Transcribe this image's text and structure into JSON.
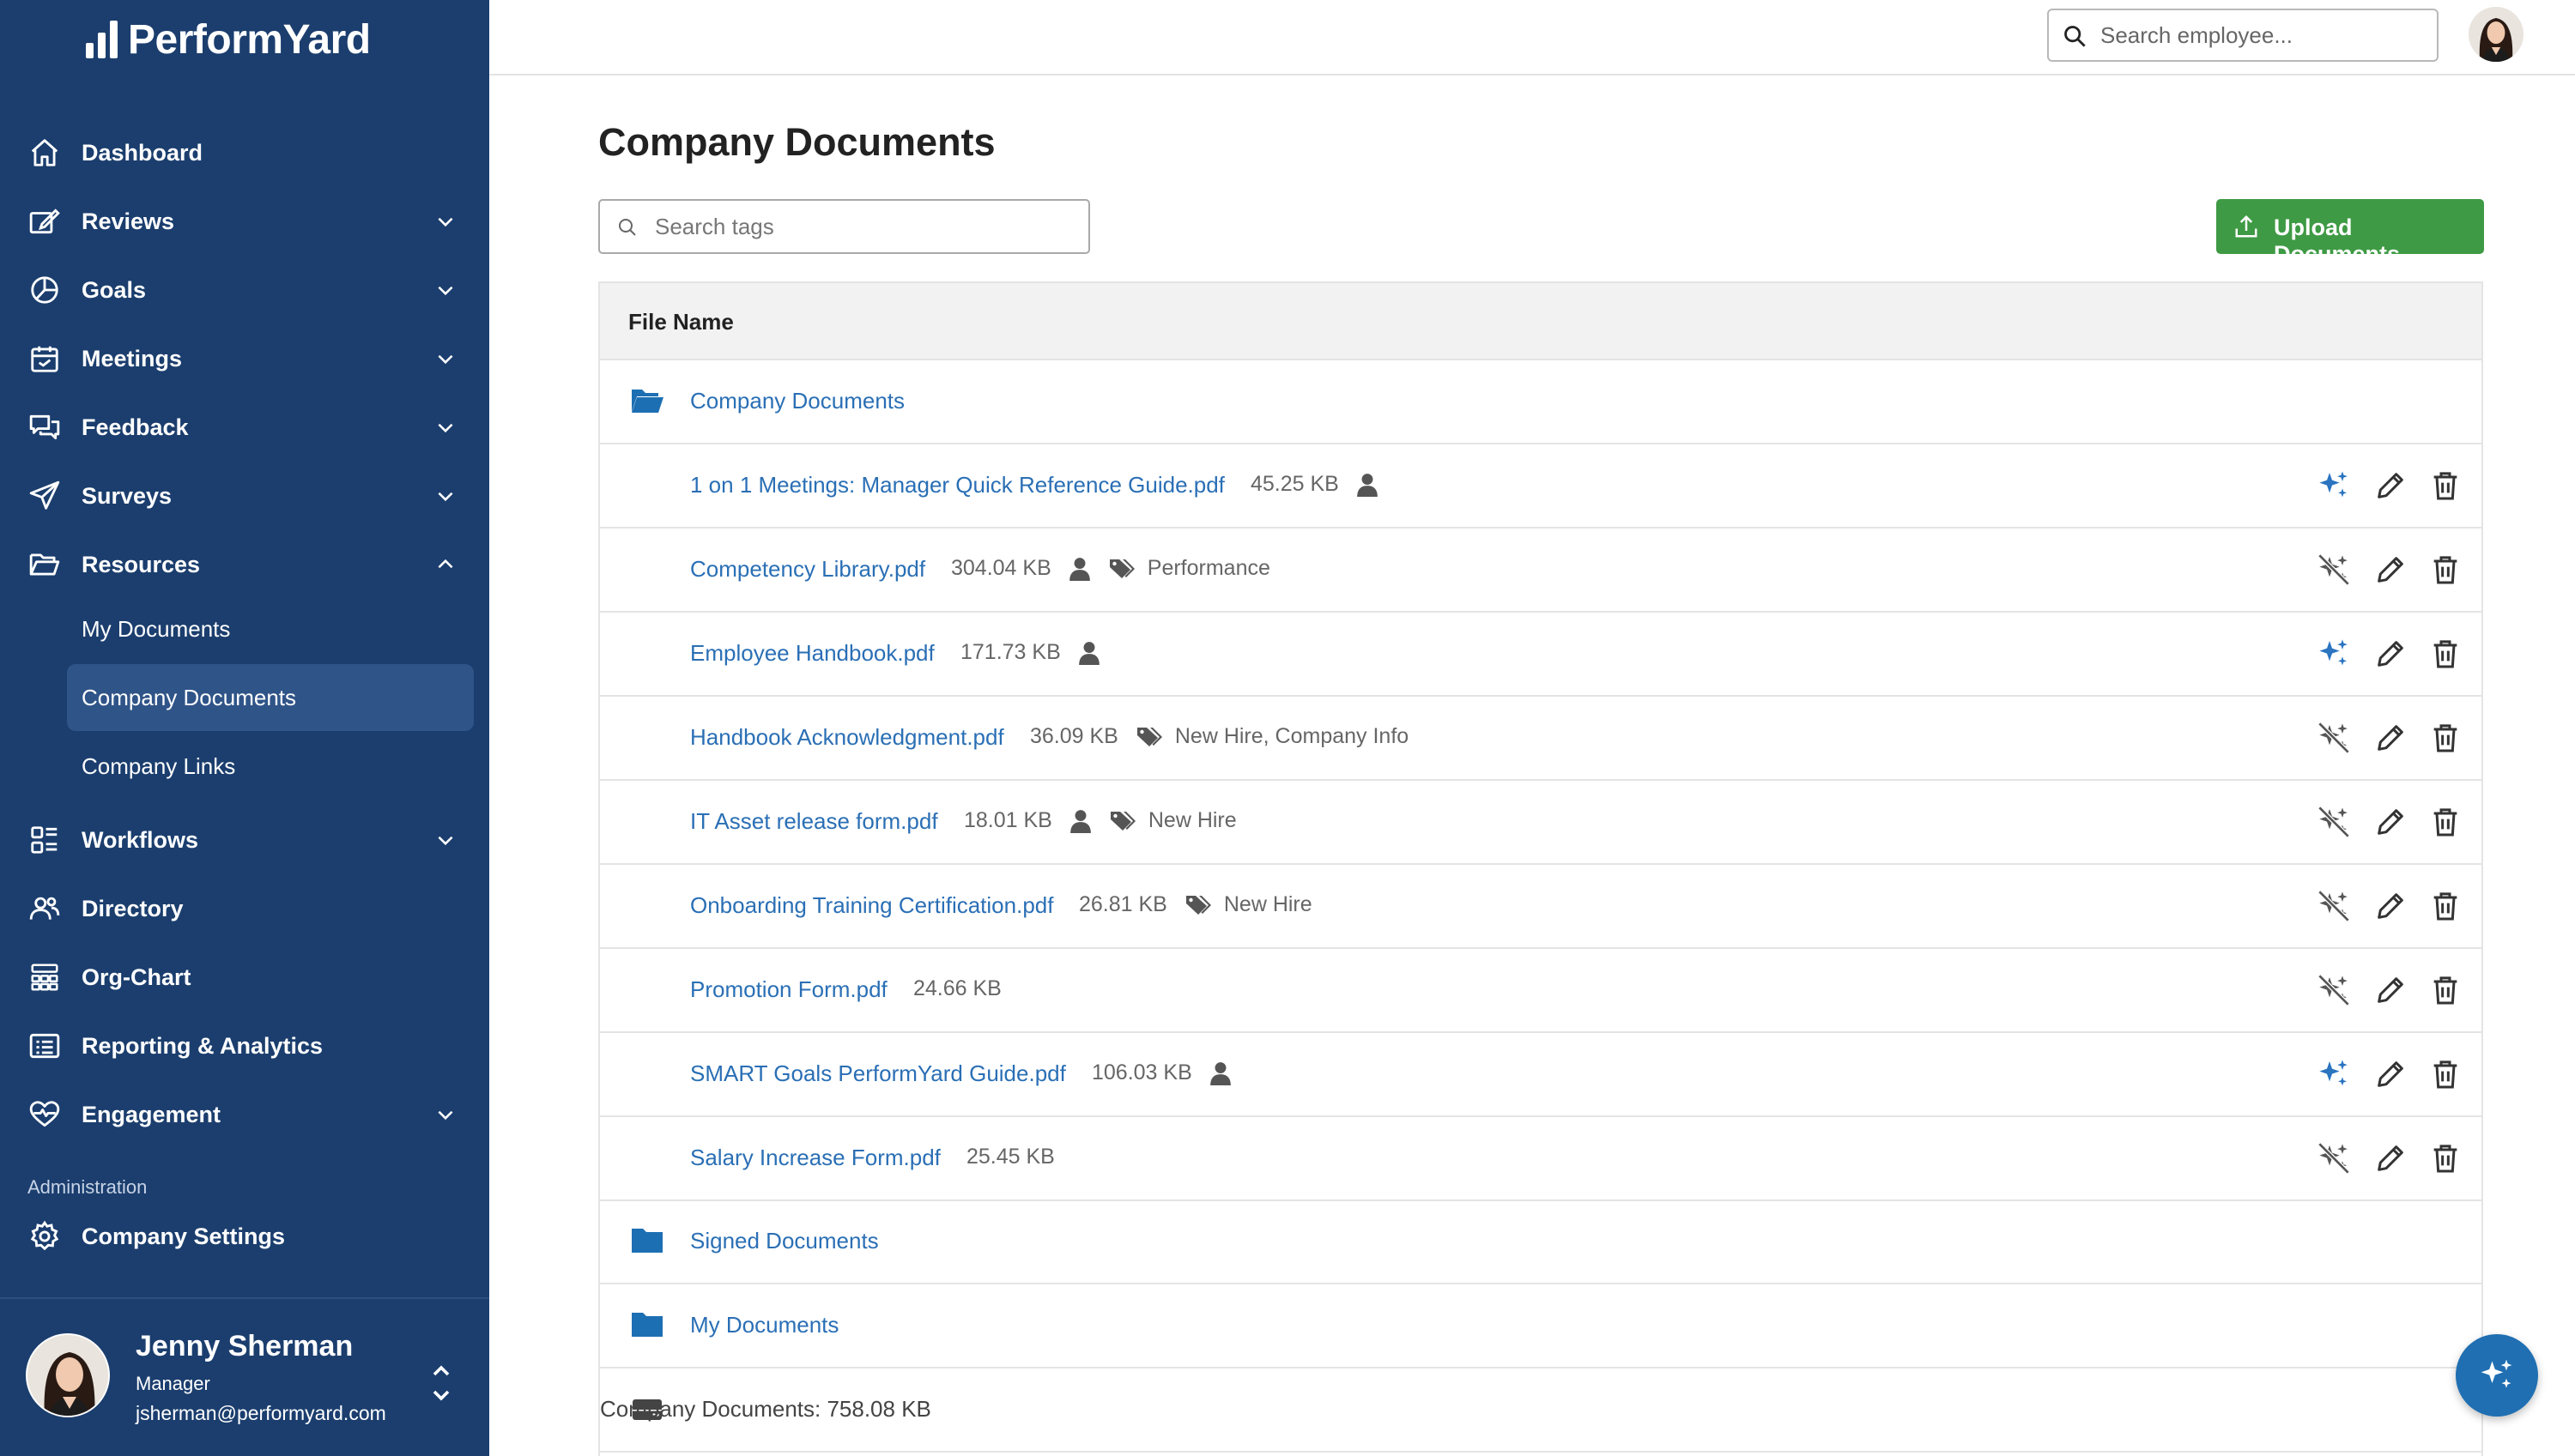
{
  "app": {
    "brand": "PerformYard"
  },
  "sidebar": {
    "nav": [
      {
        "label": "Dashboard",
        "icon": "home-icon"
      },
      {
        "label": "Reviews",
        "icon": "edit-square-icon",
        "expandable": true
      },
      {
        "label": "Goals",
        "icon": "pie-chart-icon",
        "expandable": true
      },
      {
        "label": "Meetings",
        "icon": "calendar-icon",
        "expandable": true
      },
      {
        "label": "Feedback",
        "icon": "chat-bubbles-icon",
        "expandable": true
      },
      {
        "label": "Surveys",
        "icon": "paper-plane-icon",
        "expandable": true
      },
      {
        "label": "Resources",
        "icon": "folder-open-icon",
        "expandable": true,
        "expanded": true
      },
      {
        "label": "Workflows",
        "icon": "workflow-grid-icon",
        "expandable": true
      },
      {
        "label": "Directory",
        "icon": "people-icon"
      },
      {
        "label": "Org-Chart",
        "icon": "org-chart-icon"
      },
      {
        "label": "Reporting & Analytics",
        "icon": "report-list-icon"
      },
      {
        "label": "Engagement",
        "icon": "heart-pulse-icon",
        "expandable": true
      }
    ],
    "resources_sub": [
      {
        "label": "My Documents",
        "active": false
      },
      {
        "label": "Company Documents",
        "active": true
      },
      {
        "label": "Company Links",
        "active": false
      }
    ],
    "admin_heading": "Administration",
    "admin_items": [
      {
        "label": "Company Settings",
        "icon": "gear-icon"
      }
    ],
    "user": {
      "name": "Jenny Sherman",
      "role": "Manager",
      "email": "jsherman@performyard.com"
    }
  },
  "topbar": {
    "search_placeholder": "Search employee..."
  },
  "main": {
    "title": "Company Documents",
    "tag_search_placeholder": "Search tags",
    "upload_label": "Upload Documents",
    "table": {
      "header": "File Name",
      "root_folder": "Company Documents",
      "files": [
        {
          "name": "1 on 1 Meetings: Manager Quick Reference Guide.pdf",
          "size": "45.25 KB",
          "shared_with_user": true,
          "tags": "",
          "ai_enabled": true
        },
        {
          "name": "Competency Library.pdf",
          "size": "304.04 KB",
          "shared_with_user": true,
          "tags": "Performance",
          "ai_enabled": false
        },
        {
          "name": "Employee Handbook.pdf",
          "size": "171.73 KB",
          "shared_with_user": true,
          "tags": "",
          "ai_enabled": true
        },
        {
          "name": "Handbook Acknowledgment.pdf",
          "size": "36.09 KB",
          "shared_with_user": false,
          "tags": "New Hire, Company Info",
          "ai_enabled": false
        },
        {
          "name": "IT Asset release form.pdf",
          "size": "18.01 KB",
          "shared_with_user": true,
          "tags": "New Hire",
          "ai_enabled": false
        },
        {
          "name": "Onboarding Training Certification.pdf",
          "size": "26.81 KB",
          "shared_with_user": false,
          "tags": "New Hire",
          "ai_enabled": false
        },
        {
          "name": "Promotion Form.pdf",
          "size": "24.66 KB",
          "shared_with_user": false,
          "tags": "",
          "ai_enabled": false
        },
        {
          "name": "SMART Goals PerformYard Guide.pdf",
          "size": "106.03 KB",
          "shared_with_user": true,
          "tags": "",
          "ai_enabled": true
        },
        {
          "name": "Salary Increase Form.pdf",
          "size": "25.45 KB",
          "shared_with_user": false,
          "tags": "",
          "ai_enabled": false
        }
      ],
      "subfolders": [
        "Signed Documents",
        "My Documents"
      ],
      "storage_label": "Company Documents: 758.08 KB"
    }
  },
  "colors": {
    "sidebar_bg": "#1b3e6e",
    "sidebar_active": "#2f5488",
    "link_blue": "#2a6fb5",
    "primary_green": "#3e9a44",
    "ai_active": "#2a74c0",
    "ai_inactive": "#555555",
    "fab_blue": "#1f6fb2"
  }
}
